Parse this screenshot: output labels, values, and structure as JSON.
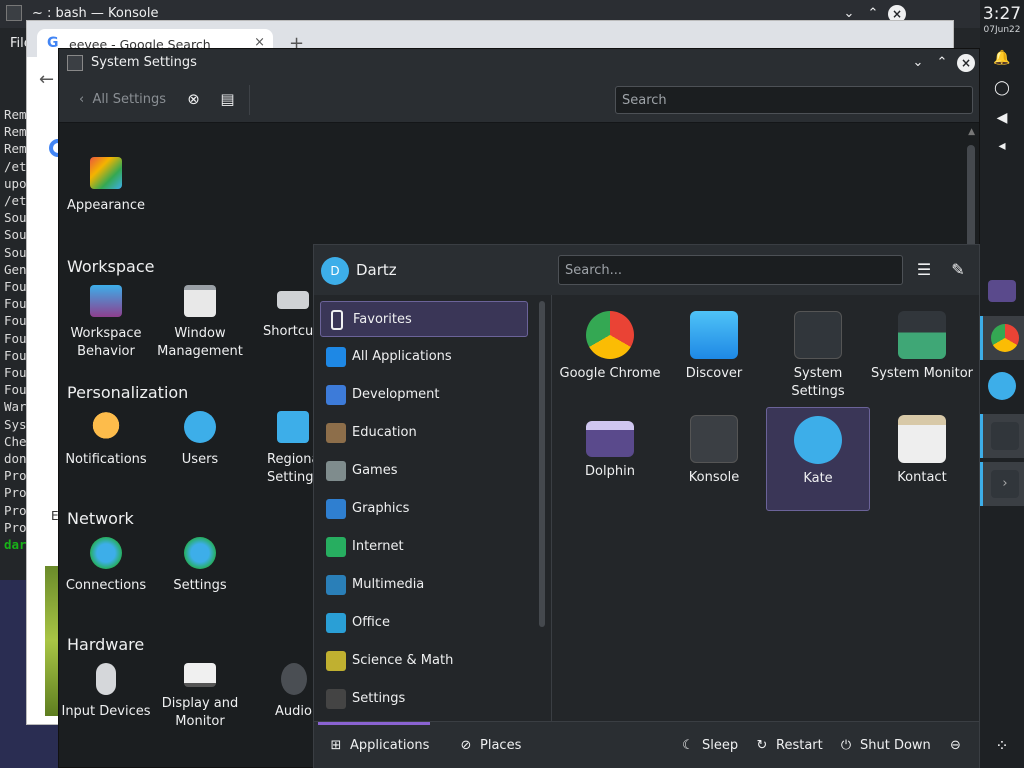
{
  "konsole": {
    "title": "~ : bash — Konsole",
    "menu_file": "File",
    "lines": [
      "Rem",
      "Rem",
      "Rem",
      "/et",
      "upo",
      "/et",
      "Sou",
      "Sou",
      "Sou",
      "Gen",
      "Fou",
      "Fou",
      "Fou",
      "Fou",
      "Fou",
      "Fou",
      "Fou",
      "War",
      "Sys",
      "Che",
      "don",
      "Pro",
      "Pro",
      "Pro",
      "Pro"
    ],
    "prompt_fragment": "dar"
  },
  "chrome": {
    "tab_title": "eevee - Google Search",
    "tab_close": "×",
    "new_tab": "+",
    "back": "←",
    "snippet": "E"
  },
  "settings": {
    "title": "System Settings",
    "back_label": "All Settings",
    "search_placeholder": "Search",
    "appearance_label": "Appearance",
    "categories": {
      "workspace": "Workspace",
      "personalization": "Personalization",
      "network": "Network",
      "hardware": "Hardware"
    },
    "workspace_items": [
      "Workspace Behavior",
      "Window Management",
      "Shortcut"
    ],
    "personalization_items": [
      "Notifications",
      "Users",
      "Regional Settings"
    ],
    "network_items": [
      "Connections",
      "Settings"
    ],
    "hardware_items": [
      "Input Devices",
      "Display and Monitor",
      "Audio"
    ]
  },
  "launcher": {
    "user": "Dartz",
    "avatar_letter": "D",
    "search_placeholder": "Search...",
    "categories": [
      "Favorites",
      "All Applications",
      "Development",
      "Education",
      "Games",
      "Graphics",
      "Internet",
      "Multimedia",
      "Office",
      "Science & Math",
      "Settings"
    ],
    "selected_category": "Favorites",
    "apps": [
      {
        "name": "Google Chrome",
        "icon": "chrome-icon"
      },
      {
        "name": "Discover",
        "icon": "discover-icon"
      },
      {
        "name": "System Settings",
        "icon": "system-settings-icon"
      },
      {
        "name": "System Monitor",
        "icon": "system-monitor-icon"
      },
      {
        "name": "Dolphin",
        "icon": "dolphin-icon"
      },
      {
        "name": "Konsole",
        "icon": "konsole-icon"
      },
      {
        "name": "Kate",
        "icon": "kate-icon"
      },
      {
        "name": "Kontact",
        "icon": "kontact-icon"
      }
    ],
    "selected_app": "Kate",
    "footer": {
      "applications": "Applications",
      "places": "Places",
      "sleep": "Sleep",
      "restart": "Restart",
      "shutdown": "Shut Down"
    }
  },
  "panel": {
    "time": "3:27",
    "date": "07Jun22"
  },
  "colors": {
    "accent": "#3daee9",
    "selection": "#3a3657",
    "selection_border": "#6b6399",
    "panel_bg": "#1e2124",
    "window_bg": "#1b1e20"
  }
}
